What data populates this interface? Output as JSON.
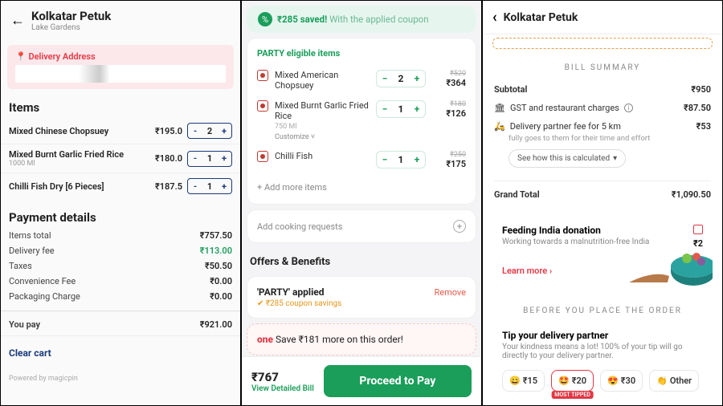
{
  "p1": {
    "title": "Kolkatar Petuk",
    "location": "Lake Gardens",
    "delivery_label": "Delivery Address",
    "items_h": "Items",
    "items": [
      {
        "name": "Mixed Chinese Chopsuey",
        "sub": "",
        "price": "₹195.0",
        "qty": "2"
      },
      {
        "name": "Mixed Burnt Garlic Fried Rice",
        "sub": "1000 Ml",
        "price": "₹180.0",
        "qty": "1"
      },
      {
        "name": "Chilli Fish Dry [6 Pieces]",
        "sub": "",
        "price": "₹187.5",
        "qty": "1"
      }
    ],
    "pay_h": "Payment details",
    "rows": [
      {
        "l": "Items total",
        "v": "₹757.50"
      },
      {
        "l": "Delivery fee",
        "v": "₹113.00",
        "green": true
      },
      {
        "l": "Taxes",
        "v": "₹50.50"
      },
      {
        "l": "Convenience Fee",
        "v": "₹0.00"
      },
      {
        "l": "Packaging Charge",
        "v": "₹0.00"
      }
    ],
    "youpay_l": "You pay",
    "youpay_v": "₹921.00",
    "clear": "Clear cart",
    "powered": "Powered by magicpin"
  },
  "p2": {
    "saved": "₹285 saved!",
    "saved_sub": "With the applied coupon",
    "party": "PARTY eligible items",
    "items": [
      {
        "veg": "red",
        "name": "Mixed American Chopsuey",
        "sub": "",
        "custom": "",
        "qty": "2",
        "strike": "₹520",
        "price": "₹364"
      },
      {
        "veg": "red",
        "name": "Mixed Burnt Garlic Fried Rice",
        "sub": "750 Ml",
        "custom": "Customize ˅",
        "qty": "1",
        "strike": "₹180",
        "price": "₹126"
      },
      {
        "veg": "red",
        "name": "Chilli Fish",
        "sub": "",
        "custom": "",
        "qty": "1",
        "strike": "₹250",
        "price": "₹175"
      }
    ],
    "addmore": "+  Add more items",
    "cooking": "Add cooking requests",
    "offers_h": "Offers & Benefits",
    "applied": "'PARTY' applied",
    "remove": "Remove",
    "savings": "₹285 coupon savings",
    "one_pre": "one",
    "one_txt": " Save ₹181 more on this order!",
    "total": "₹767",
    "detail": "View Detailed Bill",
    "proceed": "Proceed to Pay"
  },
  "p3": {
    "title": "Kolkatar Petuk",
    "summary_h": "BILL SUMMARY",
    "rows": [
      {
        "icon": "",
        "l": "Subtotal",
        "v": "₹950",
        "bold": true
      },
      {
        "icon": "🏛",
        "l": "GST and restaurant charges",
        "info": true,
        "v": "₹87.50"
      },
      {
        "icon": "🛵",
        "l": "Delivery partner fee for 5 km",
        "v": "₹53",
        "sub": "fully goes to them for their time and effort"
      }
    ],
    "seehow": "See how this is calculated",
    "grand_l": "Grand Total",
    "grand_v": "₹1,090.50",
    "dn_title": "Feeding India donation",
    "dn_sub": "Working towards a malnutrition-free India",
    "dn_amt": "₹2",
    "learn": "Learn more ›",
    "before_h": "BEFORE YOU PLACE THE ORDER",
    "tip_title": "Tip your delivery partner",
    "tip_sub": "Your kindness means a lot! 100% of your tip will go directly to your delivery partner.",
    "tips": [
      {
        "e": "😄",
        "l": "₹15"
      },
      {
        "e": "🤩",
        "l": "₹20",
        "most": "MOST TIPPED"
      },
      {
        "e": "😍",
        "l": "₹30"
      },
      {
        "e": "👏",
        "l": "Other"
      }
    ]
  }
}
